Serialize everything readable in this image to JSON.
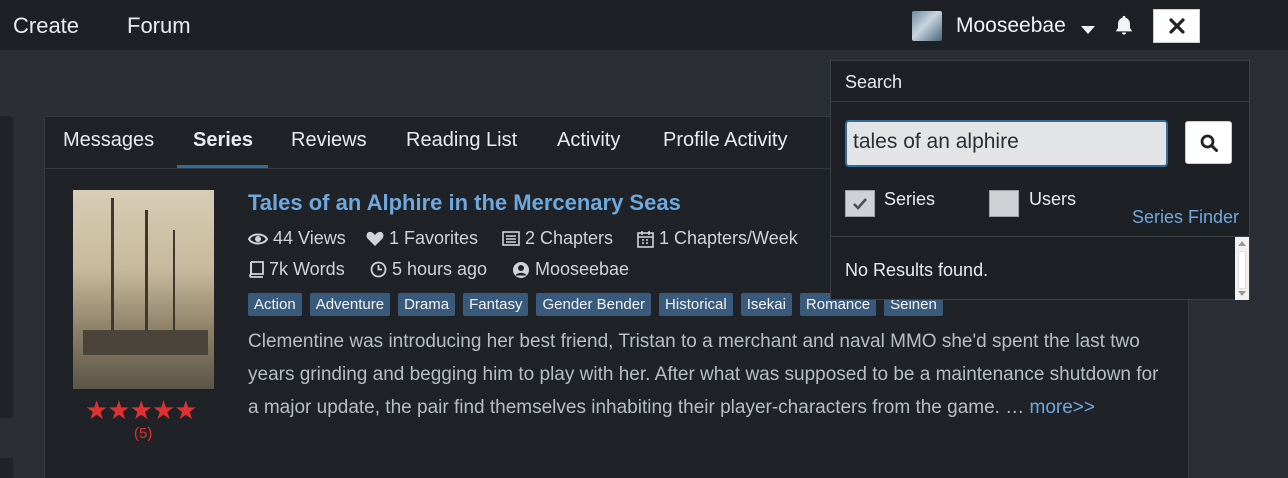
{
  "nav": {
    "create": "Create",
    "forum": "Forum",
    "username": "Mooseebae"
  },
  "tabs": [
    "Messages",
    "Series",
    "Reviews",
    "Reading List",
    "Activity",
    "Profile Activity"
  ],
  "series": {
    "title": "Tales of an Alphire in the Mercenary Seas",
    "views": "44 Views",
    "favorites": "1 Favorites",
    "chapters": "2 Chapters",
    "chapters_week": "1 Chapters/Week",
    "words": "7k Words",
    "updated": "5 hours ago",
    "author": "Mooseebae",
    "tags": [
      "Action",
      "Adventure",
      "Drama",
      "Fantasy",
      "Gender Bender",
      "Historical",
      "Isekai",
      "Romance",
      "Seinen"
    ],
    "description": "Clementine was introducing her best friend, Tristan to a merchant and naval MMO she'd spent the last two years grinding and begging him to play with her. After what was supposed to be a maintenance shutdown for a major update, the pair find themselves inhabiting their player-characters from the game. …",
    "more": "more>>",
    "stars": "★★★★★",
    "rating_count": "(5)"
  },
  "search": {
    "header": "Search",
    "value": "tales of an alphire",
    "series_label": "Series",
    "users_label": "Users",
    "series_finder": "Series Finder",
    "no_results": "No Results found."
  }
}
